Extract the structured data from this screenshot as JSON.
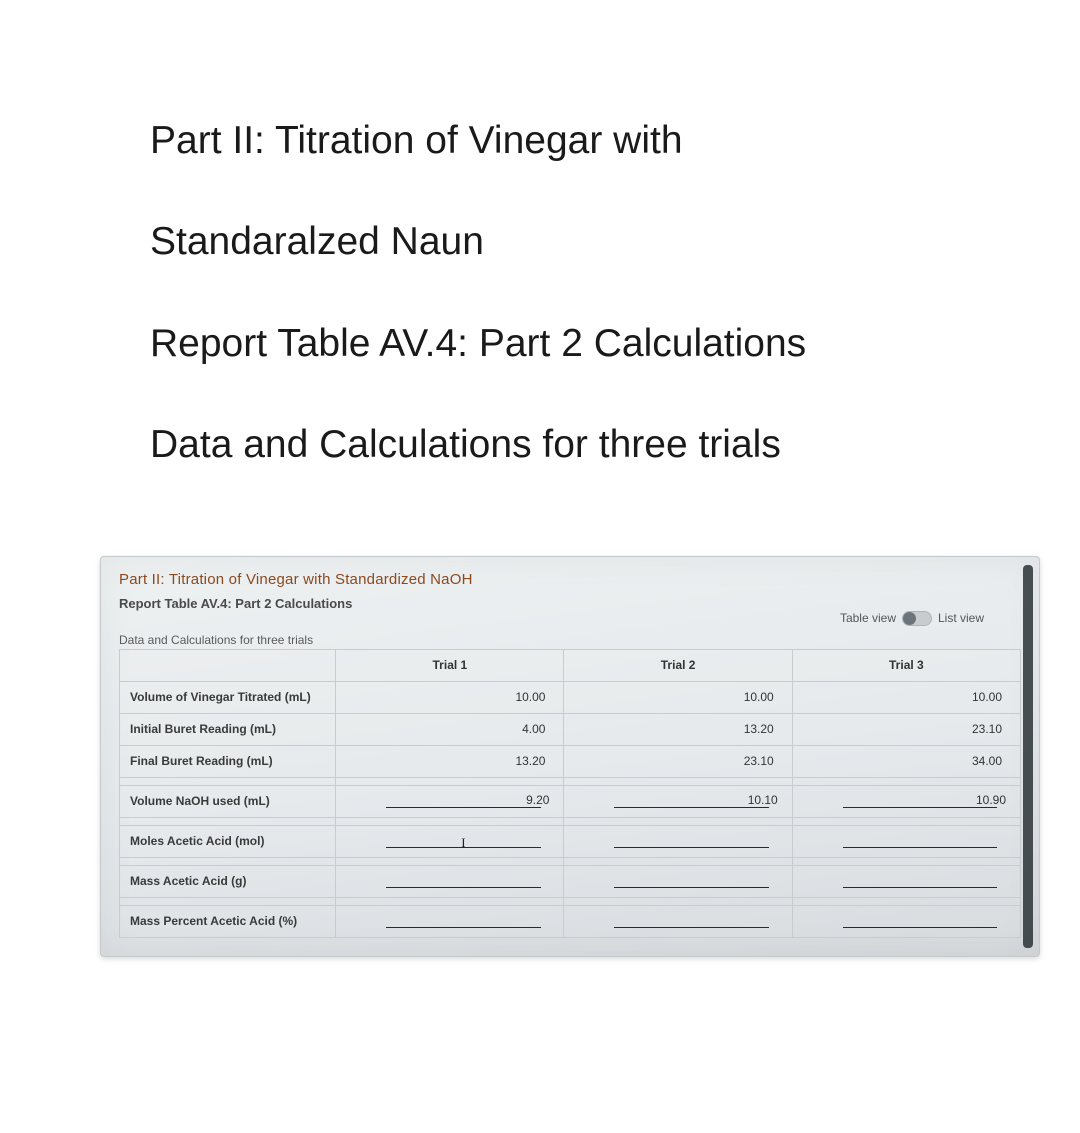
{
  "heading": {
    "line1": "Part II: Titration of Vinegar with",
    "line2": "Standaralzed Naun",
    "line3": "Report Table AV.4: Part 2 Calculations",
    "line4": "Data and Calculations for three trials"
  },
  "panel": {
    "title": "Part II: Titration of Vinegar with Standardized NaOH",
    "subtitle": "Report Table AV.4: Part 2 Calculations",
    "section_label": "Data and Calculations for three trials",
    "toggle": {
      "left_label": "Table view",
      "right_label": "List view"
    }
  },
  "table": {
    "columns": [
      "Trial 1",
      "Trial 2",
      "Trial 3"
    ],
    "rows": [
      {
        "label": "Volume of Vinegar Titrated (mL)",
        "values": [
          "10.00",
          "10.00",
          "10.00"
        ],
        "type": "static"
      },
      {
        "label": "Initial Buret Reading (mL)",
        "values": [
          "4.00",
          "13.20",
          "23.10"
        ],
        "type": "static"
      },
      {
        "label": "Final Buret Reading (mL)",
        "values": [
          "13.20",
          "23.10",
          "34.00"
        ],
        "type": "static"
      },
      {
        "label": "Volume NaOH used (mL)",
        "values": [
          "9.20",
          "10.10",
          "10.90"
        ],
        "type": "input-filled"
      },
      {
        "label": "Moles Acetic Acid (mol)",
        "values": [
          "",
          "",
          ""
        ],
        "type": "input-cursor"
      },
      {
        "label": "Mass Acetic Acid (g)",
        "values": [
          "",
          "",
          ""
        ],
        "type": "input-empty"
      },
      {
        "label": "Mass Percent Acetic Acid (%)",
        "values": [
          "",
          "",
          ""
        ],
        "type": "input-empty"
      }
    ]
  },
  "chart_data": {
    "type": "table",
    "columns": [
      "Trial 1",
      "Trial 2",
      "Trial 3"
    ],
    "rows": {
      "Volume of Vinegar Titrated (mL)": [
        10.0,
        10.0,
        10.0
      ],
      "Initial Buret Reading (mL)": [
        4.0,
        13.2,
        23.1
      ],
      "Final Buret Reading (mL)": [
        13.2,
        23.1,
        34.0
      ],
      "Volume NaOH used (mL)": [
        9.2,
        10.1,
        10.9
      ],
      "Moles Acetic Acid (mol)": [
        null,
        null,
        null
      ],
      "Mass Acetic Acid (g)": [
        null,
        null,
        null
      ],
      "Mass Percent Acetic Acid (%)": [
        null,
        null,
        null
      ]
    }
  }
}
